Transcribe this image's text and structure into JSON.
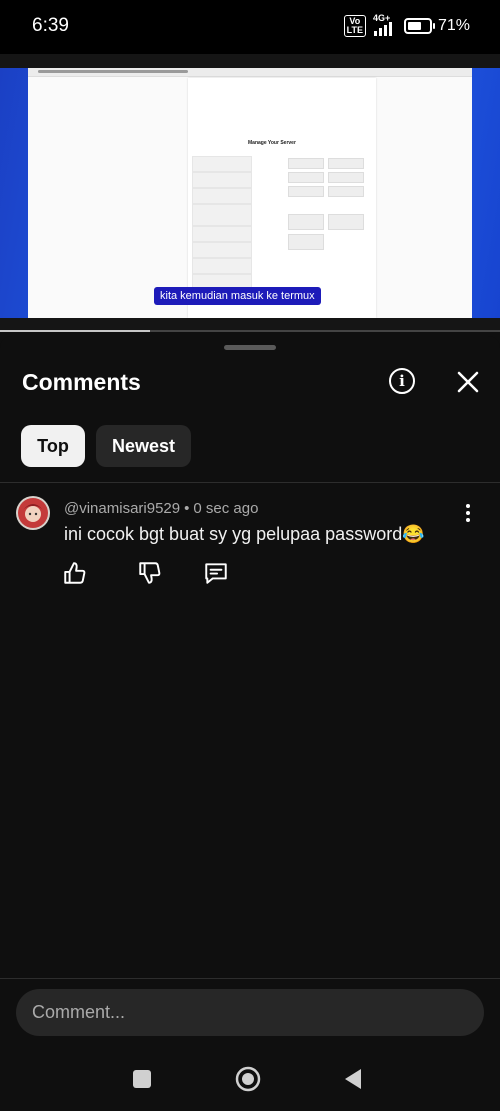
{
  "status_bar": {
    "time": "6:39",
    "volte_line1": "Vo",
    "volte_line2": "LTE",
    "network": "4G+",
    "battery_percent": "71%",
    "battery_level": 0.71
  },
  "video": {
    "caption": "kita kemudian masuk ke termux",
    "page_heading": "Manage Your Server",
    "progress_fraction": 0.3
  },
  "comments_panel": {
    "title": "Comments",
    "filters": [
      {
        "label": "Top",
        "active": true
      },
      {
        "label": "Newest",
        "active": false
      }
    ],
    "comments": [
      {
        "author": "@vinamisari9529",
        "time": "0 sec ago",
        "text": "ini cocok bgt buat sy yg pelupaa password😂"
      }
    ],
    "input_placeholder": "Comment..."
  },
  "icons": {
    "info": "info-icon",
    "close": "close-icon",
    "more": "more-vert-icon",
    "like": "thumbs-up-icon",
    "dislike": "thumbs-down-icon",
    "reply": "reply-icon",
    "nav_recents": "square-icon",
    "nav_home": "home-circle-icon",
    "nav_back": "back-triangle-icon"
  },
  "colors": {
    "background": "#0f0f0f",
    "chip_active_bg": "#f1f1f1",
    "chip_inactive_bg": "#272727",
    "caption_bg": "#1d1bb9",
    "secondary_text": "#aaaaaa"
  }
}
